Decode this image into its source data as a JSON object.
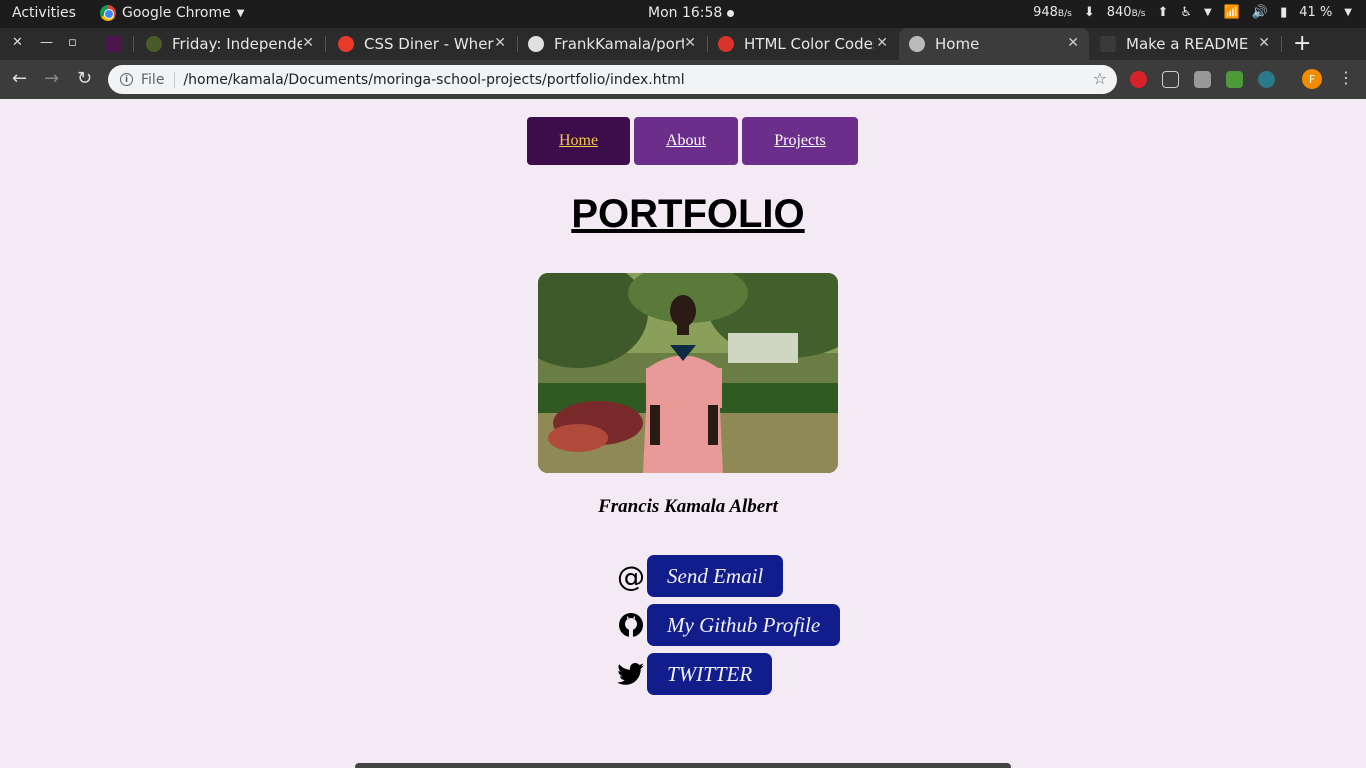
{
  "os_bar": {
    "activities": "Activities",
    "app_name": "Google Chrome",
    "clock": "Mon 16:58",
    "net_down": "948",
    "net_down_unit": "B/s",
    "net_up": "840",
    "net_up_unit": "B/s",
    "battery": "41 %"
  },
  "tabs": [
    {
      "title": "Friday: Independence"
    },
    {
      "title": "CSS Diner - Where we feed on CSS"
    },
    {
      "title": "FrankKamala/portfolio"
    },
    {
      "title": "HTML Color Codes"
    },
    {
      "title": "Home"
    },
    {
      "title": "Make a README"
    }
  ],
  "address_bar": {
    "scheme_label": "File",
    "url": "/home/kamala/Documents/moringa-school-projects/portfolio/index.html",
    "profile_initial": "F"
  },
  "page": {
    "nav": {
      "home": "Home",
      "about": "About",
      "projects": "Projects"
    },
    "title": "PORTFOLIO",
    "name": "Francis Kamala Albert",
    "links": {
      "email": "Send Email",
      "github": "My Github Profile",
      "twitter": "TWITTER"
    }
  },
  "colors": {
    "page_bg": "#f4eaf4",
    "nav_active": "#3c0d4a",
    "nav_item": "#6b2e8a",
    "nav_active_text": "#f3c74a",
    "link_button": "#121d8c"
  }
}
